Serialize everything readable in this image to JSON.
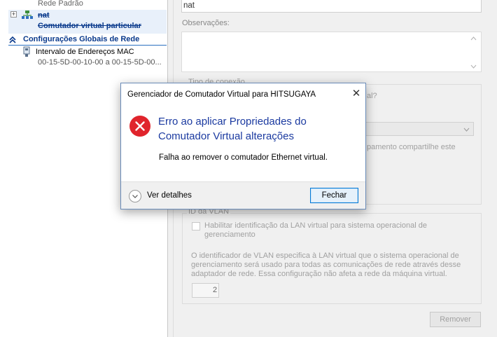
{
  "tree": {
    "rede_padrao": "Rede Padrão",
    "expand_symbol": "+",
    "nat_label": "nat",
    "nat_subtitle": "Comutador virtual particular",
    "global_settings": "Configurações Globais de Rede",
    "mac_range_title": "Intervalo de Endereços MAC",
    "mac_range_value": "00-15-5D-00-10-00 a 00-15-5D-00..."
  },
  "properties": {
    "name_value": "nat",
    "notes_label": "Observações:",
    "connection_type_label": "Tipo de conexão",
    "connection_question_fragment": "al?",
    "sharing_fragment": "pamento compartilhe este",
    "vlan_group_label": "ID da VLAN",
    "vlan_checkbox_label": "Habilitar identificação da LAN virtual para sistema operacional de gerenciamento",
    "vlan_description": "O identificador de VLAN especifica à LAN virtual que o sistema operacional de gerenciamento será usado para todas as comunicações de rede através desse adaptador de rede. Essa configuração não afeta a rede da máquina virtual.",
    "vlan_id_value": "2",
    "remove_button": "Remover"
  },
  "dialog": {
    "title": "Gerenciador de Comutador Virtual para HITSUGAYA",
    "close_symbol": "✕",
    "main_instruction": "Erro ao aplicar Propriedades do Comutador Virtual alterações",
    "content": "Falha ao remover o comutador Ethernet virtual.",
    "details_label": "Ver detalhes",
    "close_button": "Fechar"
  },
  "colors": {
    "error_red": "#e0242c",
    "instruction_blue": "#1b3aa0",
    "tree_link_blue": "#0a3a8c",
    "button_focus_blue": "#0078d7"
  },
  "icons": {
    "error": "error-circle-x-icon",
    "network": "network-switch-icon",
    "adapter": "network-adapter-icon",
    "collapse": "double-chevron-up-icon",
    "expand_details": "chevron-down-icon",
    "dropdown": "chevron-down-icon"
  }
}
